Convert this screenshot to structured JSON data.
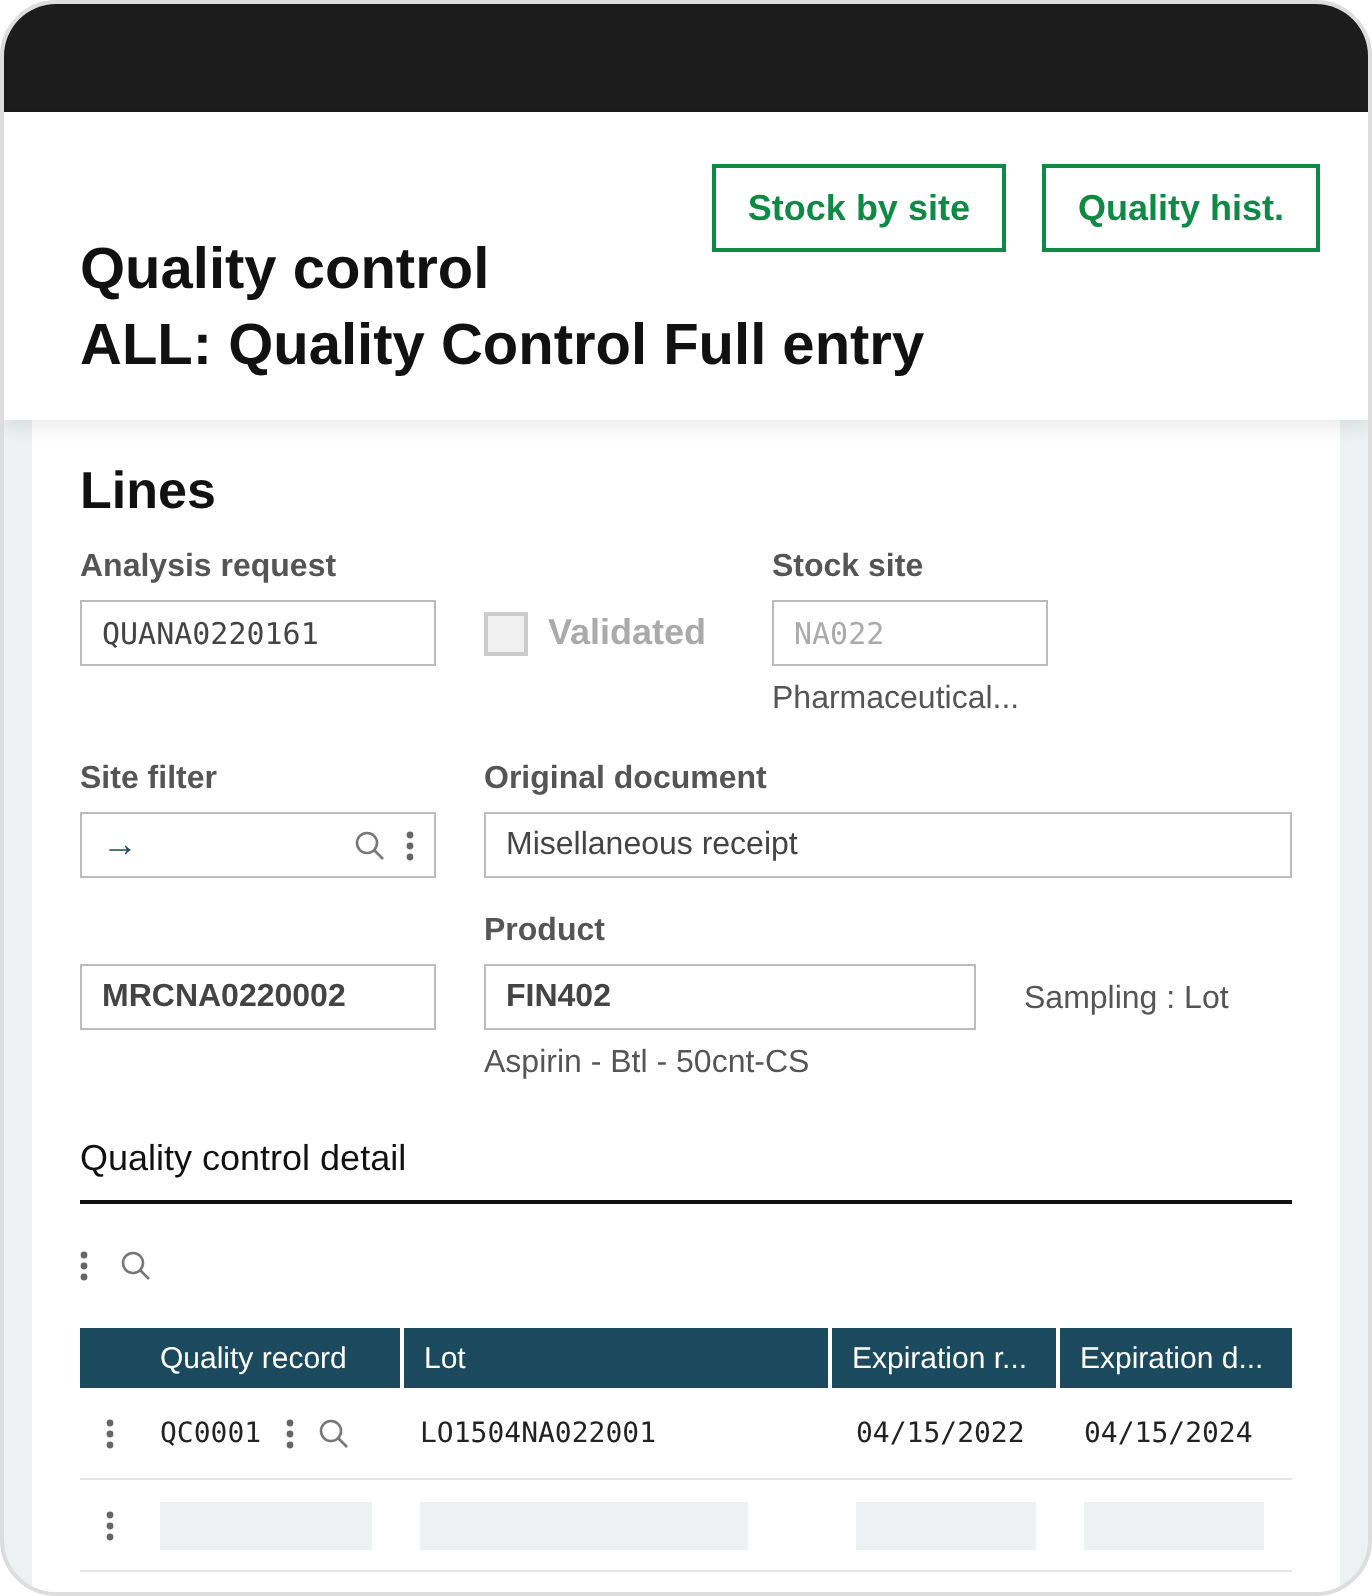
{
  "header": {
    "title": "Quality control",
    "subtitle": "ALL: Quality Control Full entry",
    "buttons": [
      "Stock by site",
      "Quality hist."
    ]
  },
  "section": {
    "title": "Lines"
  },
  "fields": {
    "analysis_request": {
      "label": "Analysis request",
      "value": "QUANA0220161"
    },
    "validated": {
      "label": "Validated",
      "checked": false,
      "disabled": true
    },
    "stock_site": {
      "label": "Stock site",
      "value": "NA022",
      "disabled": true,
      "description": "Pharmaceutical..."
    },
    "site_filter": {
      "label": "Site filter",
      "value": "→"
    },
    "original_document": {
      "label": "Original document",
      "value": "Misellaneous receipt"
    },
    "document_number": {
      "value": "MRCNA0220002"
    },
    "product": {
      "label": "Product",
      "value": "FIN402",
      "description": "Aspirin - Btl - 50cnt-CS"
    },
    "sampling": "Sampling : Lot"
  },
  "detail": {
    "title": "Quality control detail",
    "table": {
      "columns": [
        "Quality record",
        "Lot",
        "Expiration r...",
        "Expiration d..."
      ],
      "rows": [
        {
          "kind": "data",
          "cells": [
            "QC0001",
            "LO1504NA022001",
            "04/15/2022",
            "04/15/2024"
          ]
        },
        {
          "kind": "placeholder"
        }
      ]
    }
  }
}
